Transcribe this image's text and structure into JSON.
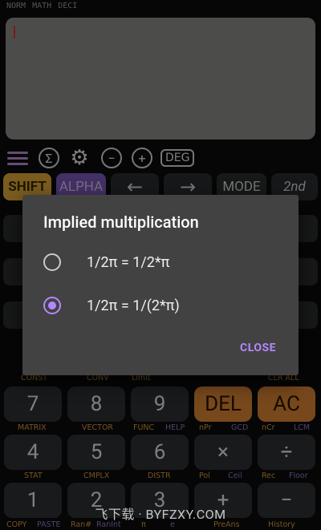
{
  "status": {
    "items": [
      "NORM",
      "MATH",
      "DECI"
    ]
  },
  "toolbar": {
    "sum_icon": "Σ",
    "settings_icon": "⚙",
    "minus_icon": "−",
    "plus_icon": "+",
    "angle_mode": "DEG"
  },
  "function_row": {
    "shift": "SHIFT",
    "alpha": "ALPHA",
    "left": "←",
    "right": "→",
    "mode": "MODE",
    "second": "2nd"
  },
  "dialog": {
    "title": "Implied multiplication",
    "options": [
      {
        "label": "1/2π = 1/2*π",
        "selected": false
      },
      {
        "label": "1/2π = 1/(2*π)",
        "selected": true
      }
    ],
    "close": "CLOSE"
  },
  "keypad": {
    "row1_labels": {
      "a": "CONST",
      "b": "CONV",
      "c": "Limit",
      "d": "CLR ALL"
    },
    "row1_keys": [
      "7",
      "8",
      "9",
      "DEL",
      "AC"
    ],
    "row2_labels": {
      "a": "MATRIX",
      "b": "VECTOR",
      "c": "FUNC",
      "c2": "HELP",
      "d": "nPr",
      "d2": "GCD",
      "e": "nCr",
      "e2": "LCM"
    },
    "row2_keys": [
      "4",
      "5",
      "6",
      "×",
      "÷"
    ],
    "row3_labels": {
      "a": "STAT",
      "b": "CMPLX",
      "c": "DISTR",
      "d": "Pol",
      "d2": "Ceil",
      "e": "Rec",
      "e2": "Floor"
    },
    "row3_keys": [
      "1",
      "2",
      "3",
      "+",
      "−"
    ],
    "row4_labels": {
      "a": "COPY",
      "a2": "PASTE",
      "b": "Ran#",
      "b2": "RanInt",
      "c": "π",
      "c2": "e",
      "d": "PreAns",
      "e": "History"
    }
  },
  "watermark": "飞下载 · BYFZXY.COM",
  "colors": {
    "accent": "#b388ff",
    "shift": "#e1a83a",
    "alpha": "#7a5ab8",
    "del_ac": "#d88333",
    "display": "#8a8d88"
  }
}
